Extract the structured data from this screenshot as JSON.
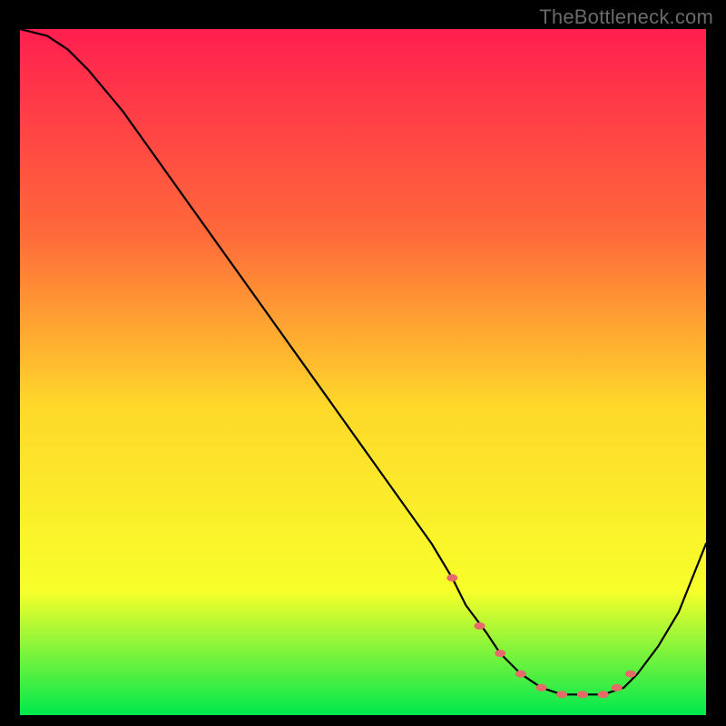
{
  "watermark": "TheBottleneck.com",
  "colors": {
    "top": "#ff1f4f",
    "q1": "#ff6a3a",
    "mid": "#ffd82a",
    "q3": "#f7ff2a",
    "bottom": "#00e84e",
    "line": "#000000",
    "dots": "#e66a6a",
    "bg": "#000000"
  },
  "chart_data": {
    "type": "line",
    "title": "",
    "xlabel": "",
    "ylabel": "",
    "xlim": [
      0,
      100
    ],
    "ylim": [
      0,
      100
    ],
    "series": [
      {
        "name": "curve",
        "x": [
          0,
          4,
          7,
          10,
          15,
          20,
          25,
          30,
          35,
          40,
          45,
          50,
          55,
          60,
          63,
          65,
          68,
          70,
          73,
          76,
          79,
          82,
          85,
          88,
          90,
          93,
          96,
          100
        ],
        "y": [
          100,
          99,
          97,
          94,
          88,
          81,
          74,
          67,
          60,
          53,
          46,
          39,
          32,
          25,
          20,
          16,
          12,
          9,
          6,
          4,
          3,
          3,
          3,
          4,
          6,
          10,
          15,
          25
        ]
      }
    ],
    "markers": {
      "name": "highlight-dots",
      "x": [
        63,
        67,
        70,
        73,
        76,
        79,
        82,
        85,
        87,
        89
      ],
      "y": [
        20,
        13,
        9,
        6,
        4,
        3,
        3,
        3,
        4,
        6
      ]
    }
  }
}
